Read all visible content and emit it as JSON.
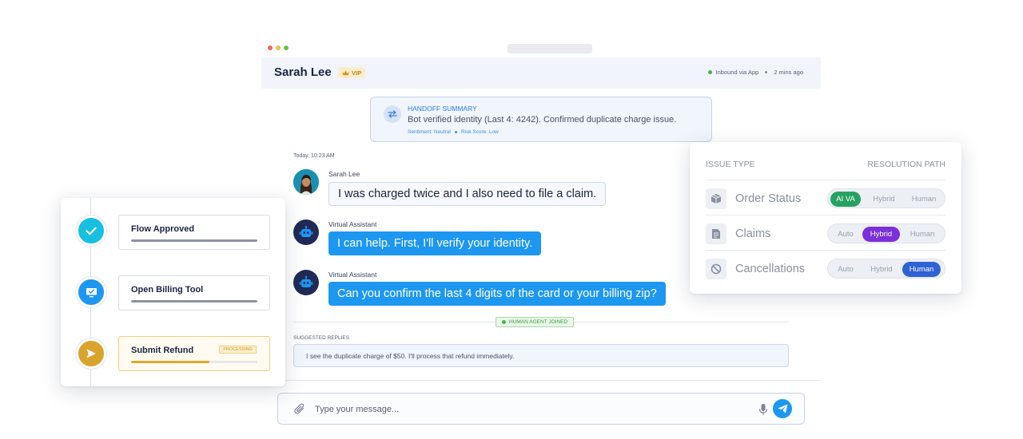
{
  "colors": {
    "accent_blue": "#1d97f0",
    "success_green": "#27a162",
    "hybrid_purple": "#7b2fd8",
    "human_blue": "#2f62d6",
    "processing_gold": "#d9a42e",
    "window_dots": [
      "#ee6a5e",
      "#f5bd4f",
      "#61c454"
    ]
  },
  "chat": {
    "header": {
      "customer_name": "Sarah Lee",
      "vip_label": "VIP",
      "vip_icon": "crown-icon",
      "channel": "Inbound via App",
      "time_ago": "2 mins ago"
    },
    "handoff": {
      "icon": "swap-arrows-icon",
      "title": "HANDOFF SUMMARY",
      "text": "Bot verified identity (Last 4: 4242). Confirmed duplicate charge issue.",
      "sentiment": "Sentiment: Neutral",
      "risk": "Risk Score: Low"
    },
    "timestamp": "Today, 10:23 AM",
    "messages": [
      {
        "sender": "Sarah Lee",
        "text": "I was charged twice and I also need to file a claim.",
        "type": "user"
      },
      {
        "sender": "Virtual Assistant",
        "text": "I can help. First, I'll verify your identity.",
        "type": "bot"
      },
      {
        "sender": "Virtual Assistant",
        "text": "Can you confirm the last 4 digits of the card or your billing zip?",
        "type": "bot"
      }
    ],
    "joined_label": "HUMAN AGENT JOINED",
    "suggested_label": "SUGGESTED REPLIES",
    "suggested_reply": "I see the duplicate charge of $50. I'll process that refund immediately.",
    "composer_placeholder": "Type your message..."
  },
  "workflow": {
    "steps": [
      {
        "label": "Flow Approved",
        "status": "done",
        "icon": "check-icon",
        "progress": 1.0
      },
      {
        "label": "Open Billing Tool",
        "status": "done",
        "icon": "monitor-icon",
        "progress": 1.0
      },
      {
        "label": "Submit Refund",
        "status": "processing",
        "icon": "send-icon",
        "badge": "PROCESSING",
        "progress": 0.62
      }
    ]
  },
  "routing": {
    "header_issue": "ISSUE TYPE",
    "header_resolution": "RESOLUTION PATH",
    "rows": [
      {
        "label": "Order Status",
        "icon": "box-icon",
        "options": [
          "AI VA",
          "Hybrid",
          "Human"
        ],
        "selected": "AI VA"
      },
      {
        "label": "Claims",
        "icon": "document-icon",
        "options": [
          "Auto",
          "Hybrid",
          "Human"
        ],
        "selected": "Hybrid"
      },
      {
        "label": "Cancellations",
        "icon": "ban-icon",
        "options": [
          "Auto",
          "Hybrid",
          "Human"
        ],
        "selected": "Human"
      }
    ]
  }
}
